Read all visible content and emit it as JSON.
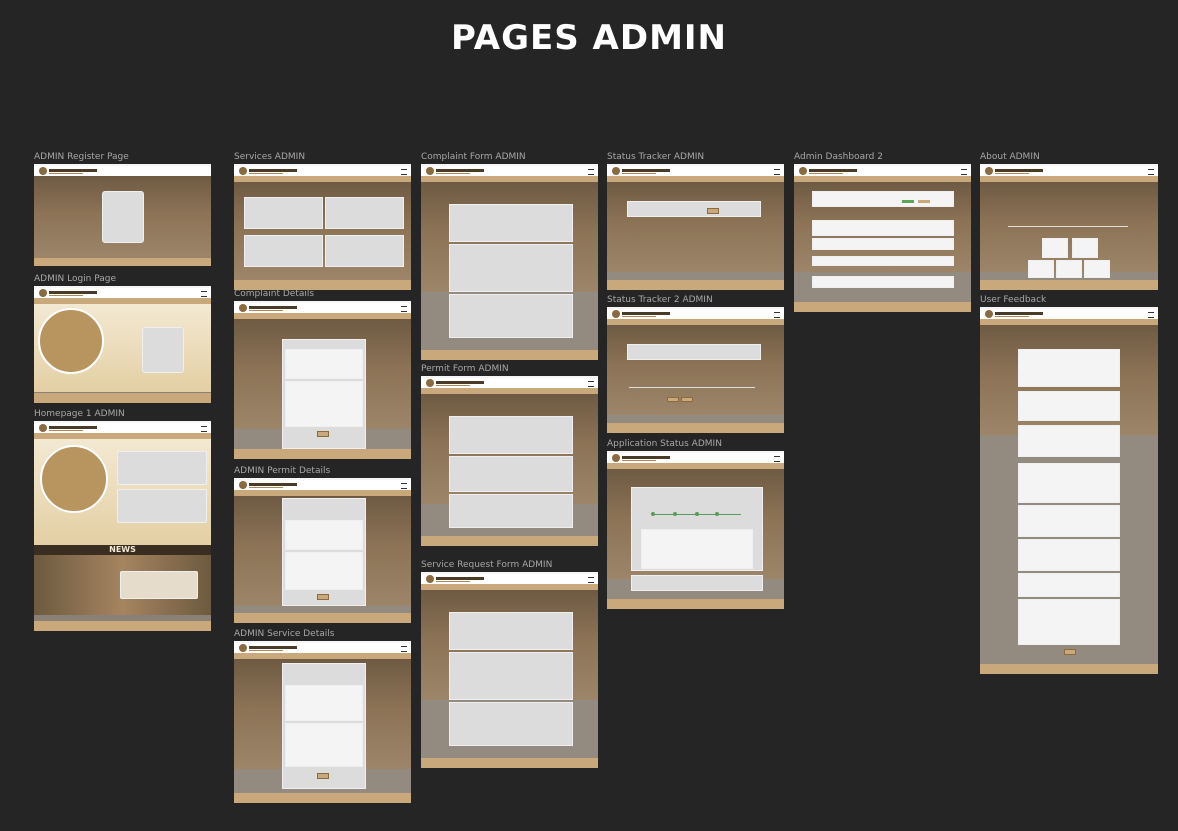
{
  "page_title": "PAGES ADMIN",
  "frames": [
    {
      "label": "ADMIN Register Page"
    },
    {
      "label": "ADMIN Login Page"
    },
    {
      "label": "Homepage 1 ADMIN"
    },
    {
      "label": "Services ADMIN"
    },
    {
      "label": "Complaint Details"
    },
    {
      "label": "ADMIN Permit Details"
    },
    {
      "label": "ADMIN Service Details"
    },
    {
      "label": "Complaint Form ADMIN"
    },
    {
      "label": "Permit Form ADMIN"
    },
    {
      "label": "Service Request Form ADMIN"
    },
    {
      "label": "Status Tracker ADMIN"
    },
    {
      "label": "Status Tracker 2 ADMIN"
    },
    {
      "label": "Application Status ADMIN"
    },
    {
      "label": "Admin Dashboard 2"
    },
    {
      "label": "About ADMIN"
    },
    {
      "label": "User Feedback"
    }
  ],
  "homepage": {
    "news_label": "NEWS"
  },
  "colors": {
    "background": "#252525",
    "accent": "#c9a87b",
    "label": "#a7a7a7"
  }
}
